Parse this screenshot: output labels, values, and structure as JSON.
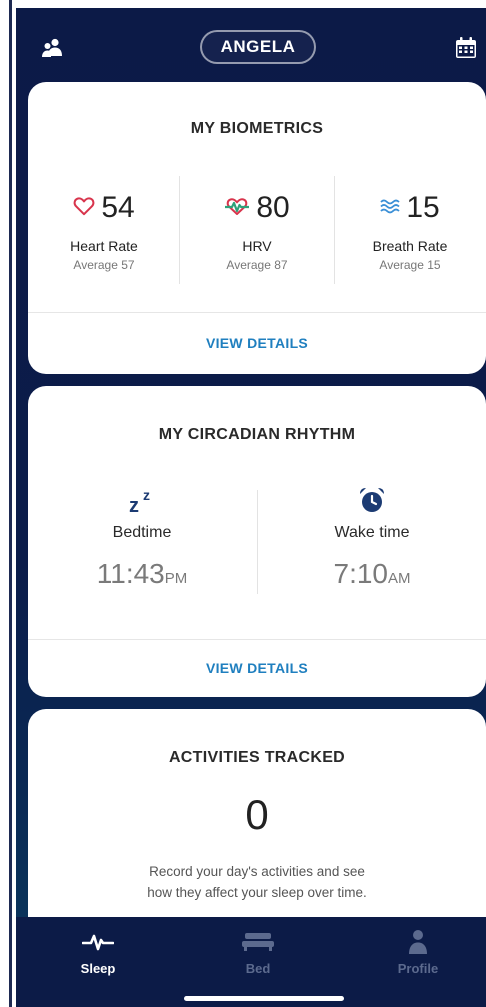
{
  "header": {
    "user_name": "ANGELA",
    "left_icon": "people-icon",
    "right_icon": "calendar-icon"
  },
  "biometrics": {
    "title": "MY BIOMETRICS",
    "metrics": [
      {
        "icon": "heart-outline-icon",
        "value": "54",
        "label": "Heart Rate",
        "average": "Average 57"
      },
      {
        "icon": "hrv-wave-icon",
        "value": "80",
        "label": "HRV",
        "average": "Average 87"
      },
      {
        "icon": "breath-waves-icon",
        "value": "15",
        "label": "Breath Rate",
        "average": "Average 15"
      }
    ],
    "view_details": "VIEW DETAILS"
  },
  "circadian": {
    "title": "MY CIRCADIAN RHYTHM",
    "bedtime": {
      "icon": "zzz-icon",
      "label": "Bedtime",
      "time": "11:43",
      "suffix": "PM"
    },
    "waketime": {
      "icon": "alarm-clock-icon",
      "label": "Wake time",
      "time": "7:10",
      "suffix": "AM"
    },
    "view_details": "VIEW DETAILS"
  },
  "activities": {
    "title": "ACTIVITIES TRACKED",
    "count": "0",
    "description_line1": "Record your day's activities and see",
    "description_line2": "how they affect your sleep over time."
  },
  "nav": {
    "items": [
      {
        "label": "Sleep",
        "icon": "pulse-icon",
        "active": true
      },
      {
        "label": "Bed",
        "icon": "bed-icon",
        "active": false
      },
      {
        "label": "Profile",
        "icon": "person-icon",
        "active": false
      }
    ]
  },
  "colors": {
    "background": "#0c1a47",
    "accent_link": "#1f7fbf",
    "heart": "#d8344c",
    "breath": "#3a8fd6",
    "icon_navy": "#1c3b73"
  }
}
